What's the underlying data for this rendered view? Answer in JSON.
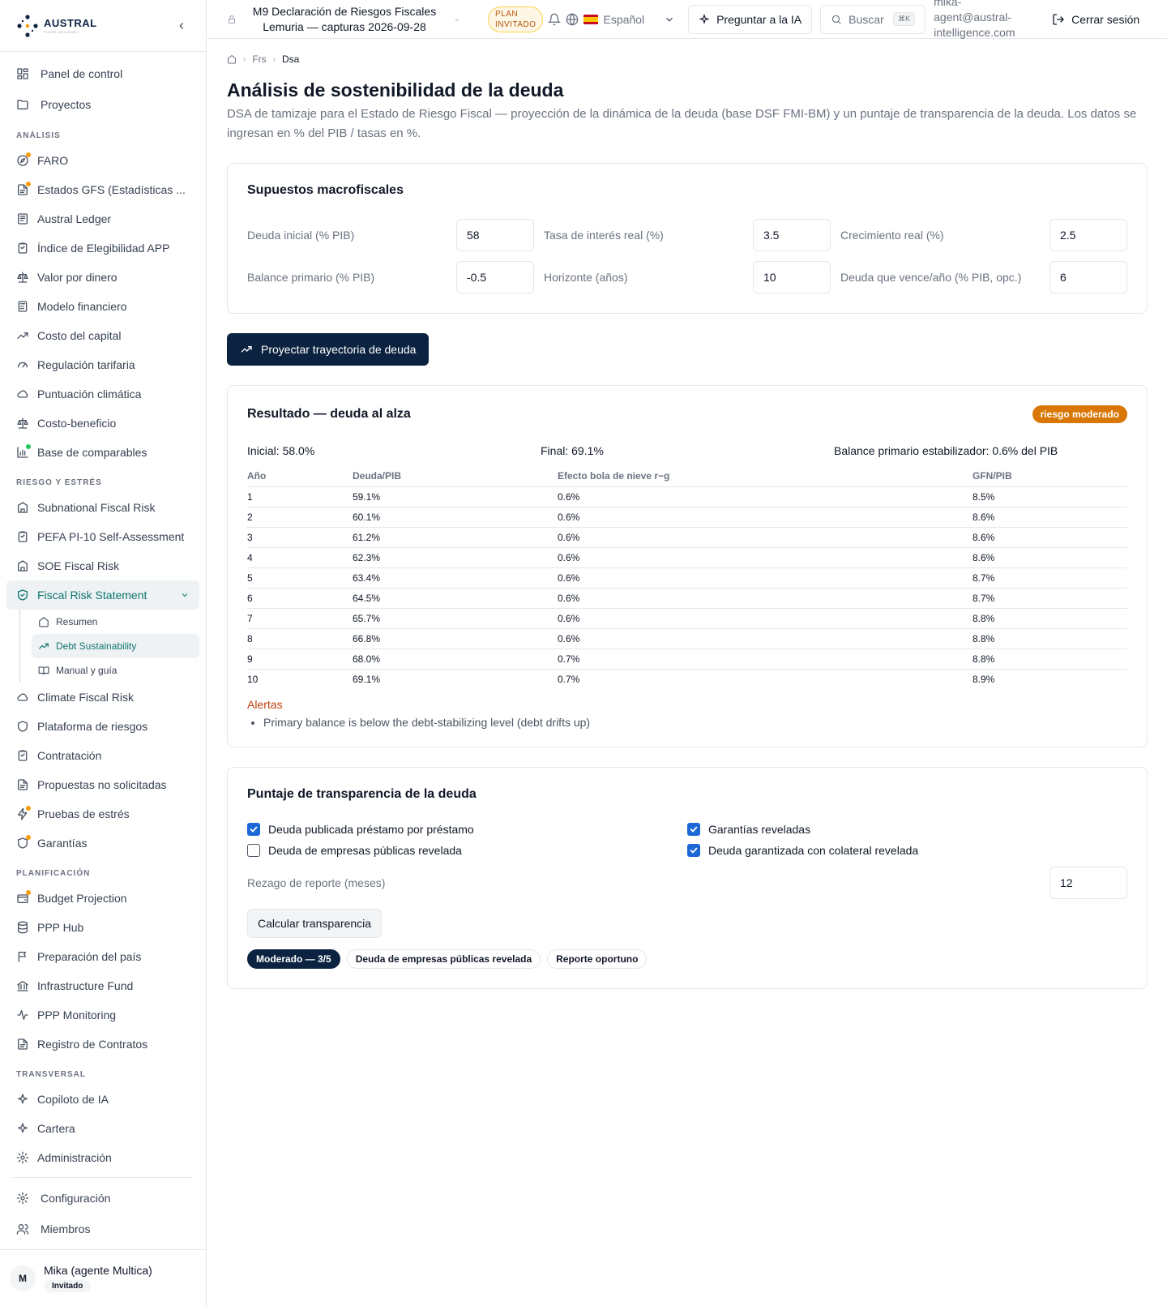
{
  "brand": {
    "name": "AUSTRAL",
    "tagline": "FISCAL ADVISORY"
  },
  "sidebar": {
    "top": [
      {
        "label": "Panel de control",
        "icon": "dashboard-icon"
      },
      {
        "label": "Proyectos",
        "icon": "folder-icon"
      }
    ],
    "sections": [
      {
        "title": "ANÁLISIS",
        "items": [
          {
            "label": "FARO",
            "icon": "compass-icon",
            "dot": "orange"
          },
          {
            "label": "Estados GFS (Estadísticas ...",
            "icon": "document-icon",
            "dot": "orange"
          },
          {
            "label": "Austral Ledger",
            "icon": "ledger-icon"
          },
          {
            "label": "Índice de Elegibilidad APP",
            "icon": "clipboard-icon"
          },
          {
            "label": "Valor por dinero",
            "icon": "scale-icon"
          },
          {
            "label": "Modelo financiero",
            "icon": "calculator-icon"
          },
          {
            "label": "Costo del capital",
            "icon": "trend-icon"
          },
          {
            "label": "Regulación tarifaria",
            "icon": "gauge-icon"
          },
          {
            "label": "Puntuación climática",
            "icon": "cloud-icon"
          },
          {
            "label": "Costo-beneficio",
            "icon": "scale-icon"
          },
          {
            "label": "Base de comparables",
            "icon": "bar-chart-icon",
            "dot": "green"
          }
        ]
      },
      {
        "title": "RIESGO Y ESTRÉS",
        "items": [
          {
            "label": "Subnational Fiscal Risk",
            "icon": "building-icon"
          },
          {
            "label": "PEFA PI-10 Self-Assessment",
            "icon": "clipboard-icon"
          },
          {
            "label": "SOE Fiscal Risk",
            "icon": "building-icon"
          }
        ]
      }
    ],
    "active": {
      "label": "Fiscal Risk Statement",
      "icon": "shield-check-icon",
      "sub": [
        {
          "label": "Resumen",
          "icon": "home-icon"
        },
        {
          "label": "Debt Sustainability",
          "icon": "trend-icon"
        },
        {
          "label": "Manual y guía",
          "icon": "book-icon"
        }
      ]
    },
    "after_active": [
      {
        "label": "Climate Fiscal Risk",
        "icon": "cloud-icon"
      },
      {
        "label": "Plataforma de riesgos",
        "icon": "shield-icon"
      },
      {
        "label": "Contratación",
        "icon": "clipboard-icon"
      },
      {
        "label": "Propuestas no solicitadas",
        "icon": "document-icon"
      },
      {
        "label": "Pruebas de estrés",
        "icon": "bolt-icon",
        "dot": "orange"
      },
      {
        "label": "Garantías",
        "icon": "shield-icon",
        "dot": "orange"
      }
    ],
    "planning": {
      "title": "PLANIFICACIÓN",
      "items": [
        {
          "label": "Budget Projection",
          "icon": "wallet-icon",
          "dot": "orange"
        },
        {
          "label": "PPP Hub",
          "icon": "database-icon"
        },
        {
          "label": "Preparación del país",
          "icon": "flag-icon"
        },
        {
          "label": "Infrastructure Fund",
          "icon": "bank-icon"
        },
        {
          "label": "PPP Monitoring",
          "icon": "pulse-icon"
        },
        {
          "label": "Registro de Contratos",
          "icon": "document-icon"
        }
      ]
    },
    "transversal": {
      "title": "TRANSVERSAL",
      "items": [
        {
          "label": "Copiloto de IA",
          "icon": "sparkle-icon"
        },
        {
          "label": "Cartera",
          "icon": "sparkle-icon"
        },
        {
          "label": "Administración",
          "icon": "gear-icon"
        }
      ]
    },
    "bottom": [
      {
        "label": "Configuración",
        "icon": "gear-icon"
      },
      {
        "label": "Miembros",
        "icon": "users-icon"
      }
    ],
    "user": {
      "initial": "M",
      "name": "Mika (agente Multica)",
      "role": "Invitado"
    }
  },
  "header": {
    "project_line1": "M9 Declaración de Riesgos Fiscales",
    "project_line2": "Lemuria — capturas 2026-09-28",
    "plan_line1": "PLAN",
    "plan_line2": "INVITADO",
    "language": "Español",
    "ask_ai": "Preguntar a la IA",
    "search_placeholder": "Buscar",
    "search_kbd": "⌘K",
    "email": "mika-agent@austral-intelligence.com",
    "logout": "Cerrar sesión"
  },
  "breadcrumb": {
    "level1": "Frs",
    "level2": "Dsa"
  },
  "page": {
    "title": "Análisis de sostenibilidad de la deuda",
    "description": "DSA de tamizaje para el Estado de Riesgo Fiscal — proyección de la dinámica de la deuda (base DSF FMI-BM) y un puntaje de transparencia de la deuda. Los datos se ingresan en % del PIB / tasas en %."
  },
  "assumptions": {
    "title": "Supuestos macrofiscales",
    "fields": [
      {
        "label": "Deuda inicial (% PIB)",
        "value": "58"
      },
      {
        "label": "Tasa de interés real (%)",
        "value": "3.5"
      },
      {
        "label": "Crecimiento real (%)",
        "value": "2.5"
      },
      {
        "label": "Balance primario (% PIB)",
        "value": "-0.5"
      },
      {
        "label": "Horizonte (años)",
        "value": "10"
      },
      {
        "label": "Deuda que vence/año (% PIB, opc.)",
        "value": "6"
      }
    ],
    "project_button": "Proyectar trayectoria de deuda"
  },
  "result": {
    "title": "Resultado — deuda al alza",
    "risk_badge": "riesgo moderado",
    "initial": "Inicial: 58.0%",
    "final": "Final: 69.1%",
    "stabilizing": "Balance primario estabilizador: 0.6% del PIB",
    "columns": [
      "Año",
      "Deuda/PIB",
      "Efecto bola de nieve r−g",
      "GFN/PIB"
    ],
    "rows": [
      [
        "1",
        "59.1%",
        "0.6%",
        "8.5%"
      ],
      [
        "2",
        "60.1%",
        "0.6%",
        "8.6%"
      ],
      [
        "3",
        "61.2%",
        "0.6%",
        "8.6%"
      ],
      [
        "4",
        "62.3%",
        "0.6%",
        "8.6%"
      ],
      [
        "5",
        "63.4%",
        "0.6%",
        "8.7%"
      ],
      [
        "6",
        "64.5%",
        "0.6%",
        "8.7%"
      ],
      [
        "7",
        "65.7%",
        "0.6%",
        "8.8%"
      ],
      [
        "8",
        "66.8%",
        "0.6%",
        "8.8%"
      ],
      [
        "9",
        "68.0%",
        "0.7%",
        "8.8%"
      ],
      [
        "10",
        "69.1%",
        "0.7%",
        "8.9%"
      ]
    ],
    "alerts_title": "Alertas",
    "alerts": [
      "Primary balance is below the debt-stabilizing level (debt drifts up)"
    ]
  },
  "transparency": {
    "title": "Puntaje de transparencia de la deuda",
    "checks": [
      {
        "label": "Deuda publicada préstamo por préstamo",
        "checked": true
      },
      {
        "label": "Garantías reveladas",
        "checked": true
      },
      {
        "label": "Deuda de empresas públicas revelada",
        "checked": false
      },
      {
        "label": "Deuda garantizada con colateral revelada",
        "checked": true
      }
    ],
    "lag_label": "Rezago de reporte (meses)",
    "lag_value": "12",
    "calc_button": "Calcular transparencia",
    "pills": [
      "Moderado — 3/5",
      "Deuda de empresas públicas revelada",
      "Reporte oportuno"
    ]
  },
  "colors": {
    "navy": "#0b2340",
    "teal": "#0f766e",
    "orange": "#d97706",
    "checkbox": "#1d66d6"
  }
}
